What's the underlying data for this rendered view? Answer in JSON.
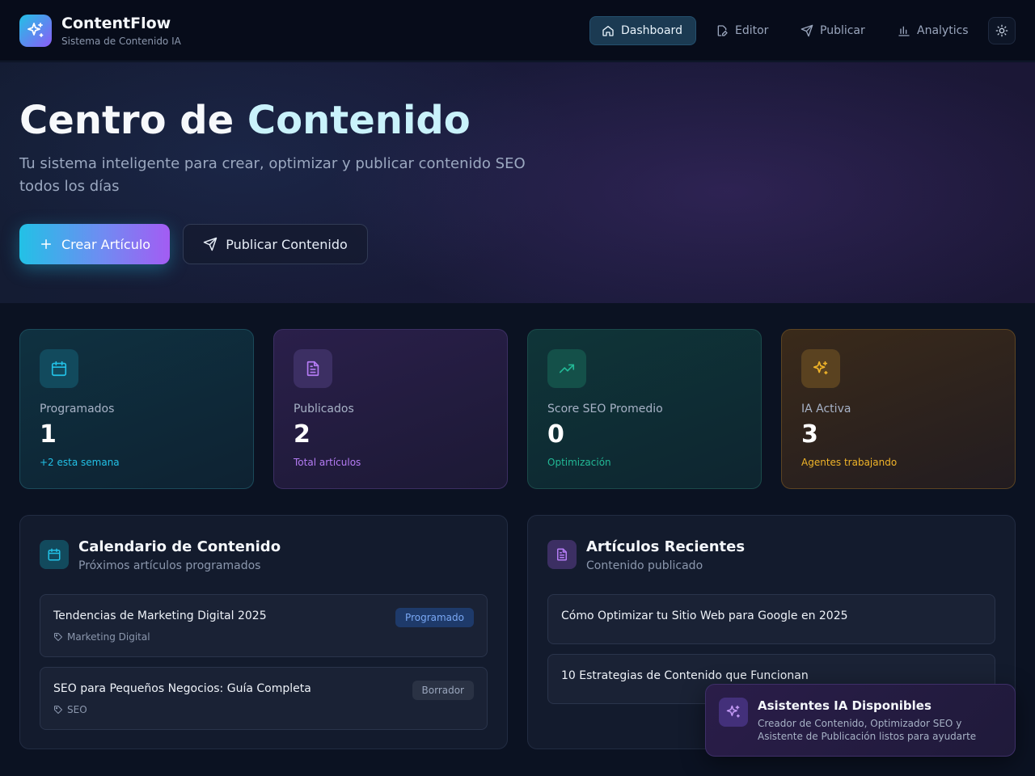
{
  "app": {
    "name": "ContentFlow",
    "subtitle": "Sistema de Contenido IA",
    "logo_icon": "sparkles-icon"
  },
  "nav": {
    "items": [
      {
        "label": "Dashboard",
        "icon": "home-icon",
        "active": true
      },
      {
        "label": "Editor",
        "icon": "file-edit-icon",
        "active": false
      },
      {
        "label": "Publicar",
        "icon": "send-icon",
        "active": false
      },
      {
        "label": "Analytics",
        "icon": "bar-chart-icon",
        "active": false
      }
    ],
    "theme_toggle_icon": "sun-icon"
  },
  "hero": {
    "title_part1": "Centro de",
    "title_part2": "Contenido",
    "description": "Tu sistema inteligente para crear, optimizar y publicar contenido SEO todos los días",
    "primary_button": "Crear Artículo",
    "secondary_button": "Publicar Contenido"
  },
  "stats": [
    {
      "label": "Programados",
      "value": "1",
      "sub": "+2 esta semana",
      "icon": "calendar-icon",
      "accent": "#22c1e6"
    },
    {
      "label": "Publicados",
      "value": "2",
      "sub": "Total artículos",
      "icon": "file-text-icon",
      "accent": "#b57cf5"
    },
    {
      "label": "Score SEO Promedio",
      "value": "0",
      "sub": "Optimización",
      "icon": "trending-up-icon",
      "accent": "#22b996"
    },
    {
      "label": "IA Activa",
      "value": "3",
      "sub": "Agentes trabajando",
      "icon": "sparkles-icon",
      "accent": "#f0b429"
    }
  ],
  "calendar_panel": {
    "title": "Calendario de Contenido",
    "subtitle": "Próximos artículos programados",
    "items": [
      {
        "title": "Tendencias de Marketing Digital 2025",
        "tag": "Marketing Digital",
        "status": "Programado"
      },
      {
        "title": "SEO para Pequeños Negocios: Guía Completa",
        "tag": "SEO",
        "status": "Borrador"
      }
    ]
  },
  "recent_panel": {
    "title": "Artículos Recientes",
    "subtitle": "Contenido publicado",
    "items": [
      {
        "title": "Cómo Optimizar tu Sitio Web para Google en 2025"
      },
      {
        "title": "10 Estrategias de Contenido que Funcionan"
      }
    ]
  },
  "toast": {
    "title": "Asistentes IA Disponibles",
    "text": "Creador de Contenido, Optimizador SEO y Asistente de Publicación listos para ayudarte"
  }
}
